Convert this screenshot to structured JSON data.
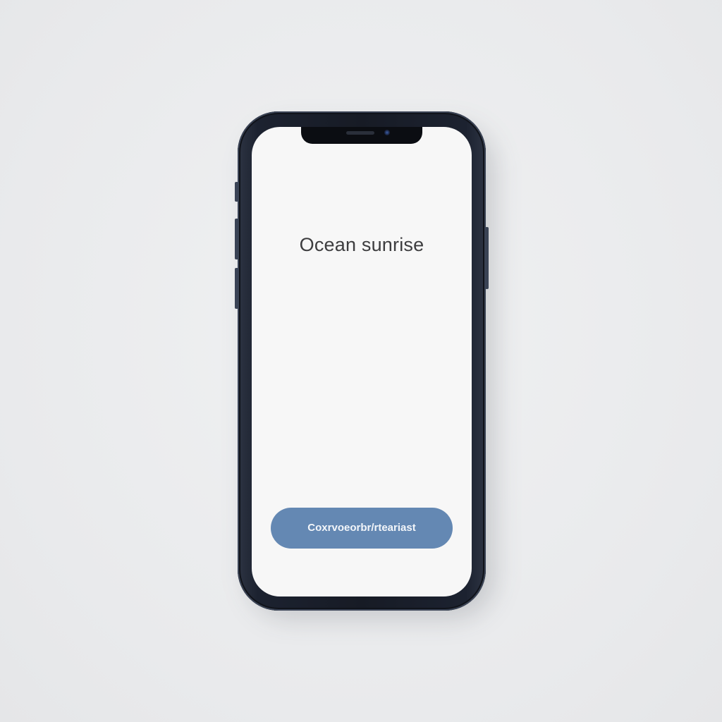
{
  "screen": {
    "title": "Ocean sunrise",
    "primary_button_label": "Coxrvoeorbr/rteariast"
  },
  "icons": {
    "front_camera": "camera-icon",
    "earpiece": "speaker-icon"
  },
  "colors": {
    "background": "#ebecee",
    "phone_frame": "#1c2230",
    "screen": "#f7f7f7",
    "button": "#6488b3",
    "title_text": "#3d3d3f"
  }
}
